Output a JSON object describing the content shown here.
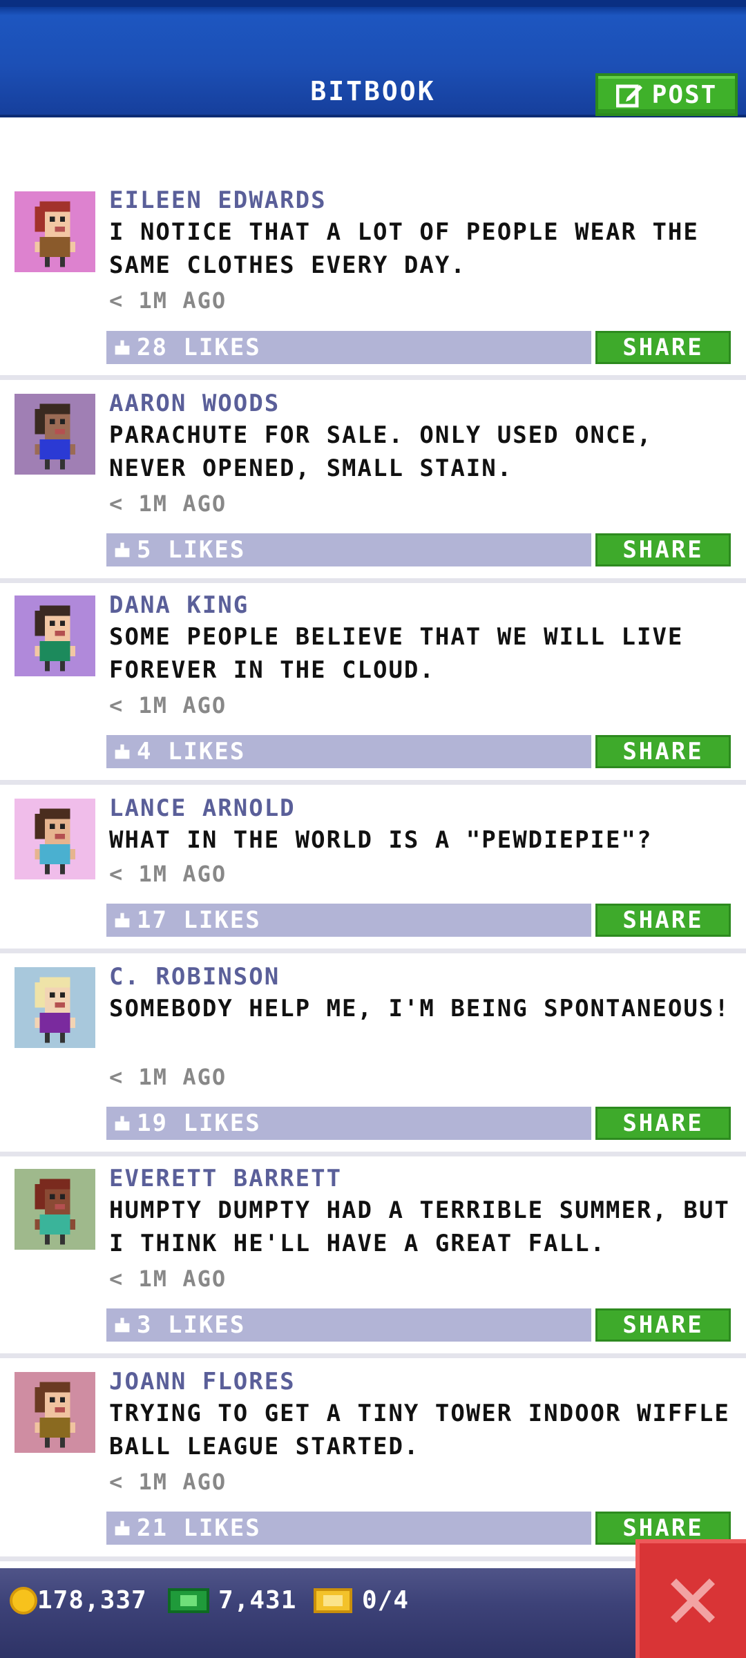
{
  "header": {
    "title": "BITBOOK",
    "post_label": "POST"
  },
  "posts": [
    {
      "name": "EILEEN EDWARDS",
      "text": "I NOTICE THAT A LOT OF PEOPLE WEAR THE SAME CLOTHES EVERY DAY.",
      "time": "< 1M AGO",
      "likes": "28 LIKES",
      "share": "SHARE",
      "avatar_bg": "#dd82cf",
      "skin": "#f2c7a4",
      "hair": "#a2322b",
      "shirt": "#8a5a2b"
    },
    {
      "name": "AARON WOODS",
      "text": "PARACHUTE FOR SALE. ONLY USED ONCE, NEVER OPENED, SMALL STAIN.",
      "time": "< 1M AGO",
      "likes": "5 LIKES",
      "share": "SHARE",
      "avatar_bg": "#a07fb4",
      "skin": "#9b6b55",
      "hair": "#3a2a20",
      "shirt": "#2b3ad4"
    },
    {
      "name": "DANA KING",
      "text": "SOME PEOPLE BELIEVE THAT WE WILL LIVE FOREVER IN THE CLOUD.",
      "time": "< 1M AGO",
      "likes": "4 LIKES",
      "share": "SHARE",
      "avatar_bg": "#b089da",
      "skin": "#f2c7a4",
      "hair": "#3b2a22",
      "shirt": "#1c8a5c"
    },
    {
      "name": "LANCE ARNOLD",
      "text": "WHAT IN THE WORLD IS A \"PEWDIEPIE\"?",
      "time": "< 1M AGO",
      "likes": "17 LIKES",
      "share": "SHARE",
      "avatar_bg": "#f0bdea",
      "skin": "#e6b48f",
      "hair": "#4a2d1e",
      "shirt": "#4ab0d0"
    },
    {
      "name": "C. ROBINSON",
      "text": "SOMEBODY HELP ME, I'M BEING SPONTANEOUS!",
      "time": "< 1M AGO",
      "likes": "19 LIKES",
      "share": "SHARE",
      "avatar_bg": "#a8c8dc",
      "skin": "#f2d4b4",
      "hair": "#efe3a8",
      "shirt": "#7a2a9e"
    },
    {
      "name": "EVERETT BARRETT",
      "text": "HUMPTY DUMPTY HAD A TERRIBLE SUMMER, BUT I THINK HE'LL HAVE A GREAT FALL.",
      "time": "< 1M AGO",
      "likes": "3 LIKES",
      "share": "SHARE",
      "avatar_bg": "#9fb98c",
      "skin": "#8a4a34",
      "hair": "#7a2a1e",
      "shirt": "#3ab49a"
    },
    {
      "name": "JOANN FLORES",
      "text": "TRYING TO GET A TINY TOWER INDOOR WIFFLE BALL LEAGUE STARTED.",
      "time": "< 1M AGO",
      "likes": "21 LIKES",
      "share": "SHARE",
      "avatar_bg": "#cf8da2",
      "skin": "#f0c3a0",
      "hair": "#6a3a22",
      "shirt": "#8a6a20"
    }
  ],
  "bottom": {
    "coins": "178,337",
    "bux": "7,431",
    "tickets": "0/4"
  },
  "colors": {
    "header": "#1c4fb5",
    "share_green": "#3eaa2b",
    "like_bar": "#b2b4d6",
    "name_color": "#5a5f99",
    "close_red": "#d93436"
  }
}
